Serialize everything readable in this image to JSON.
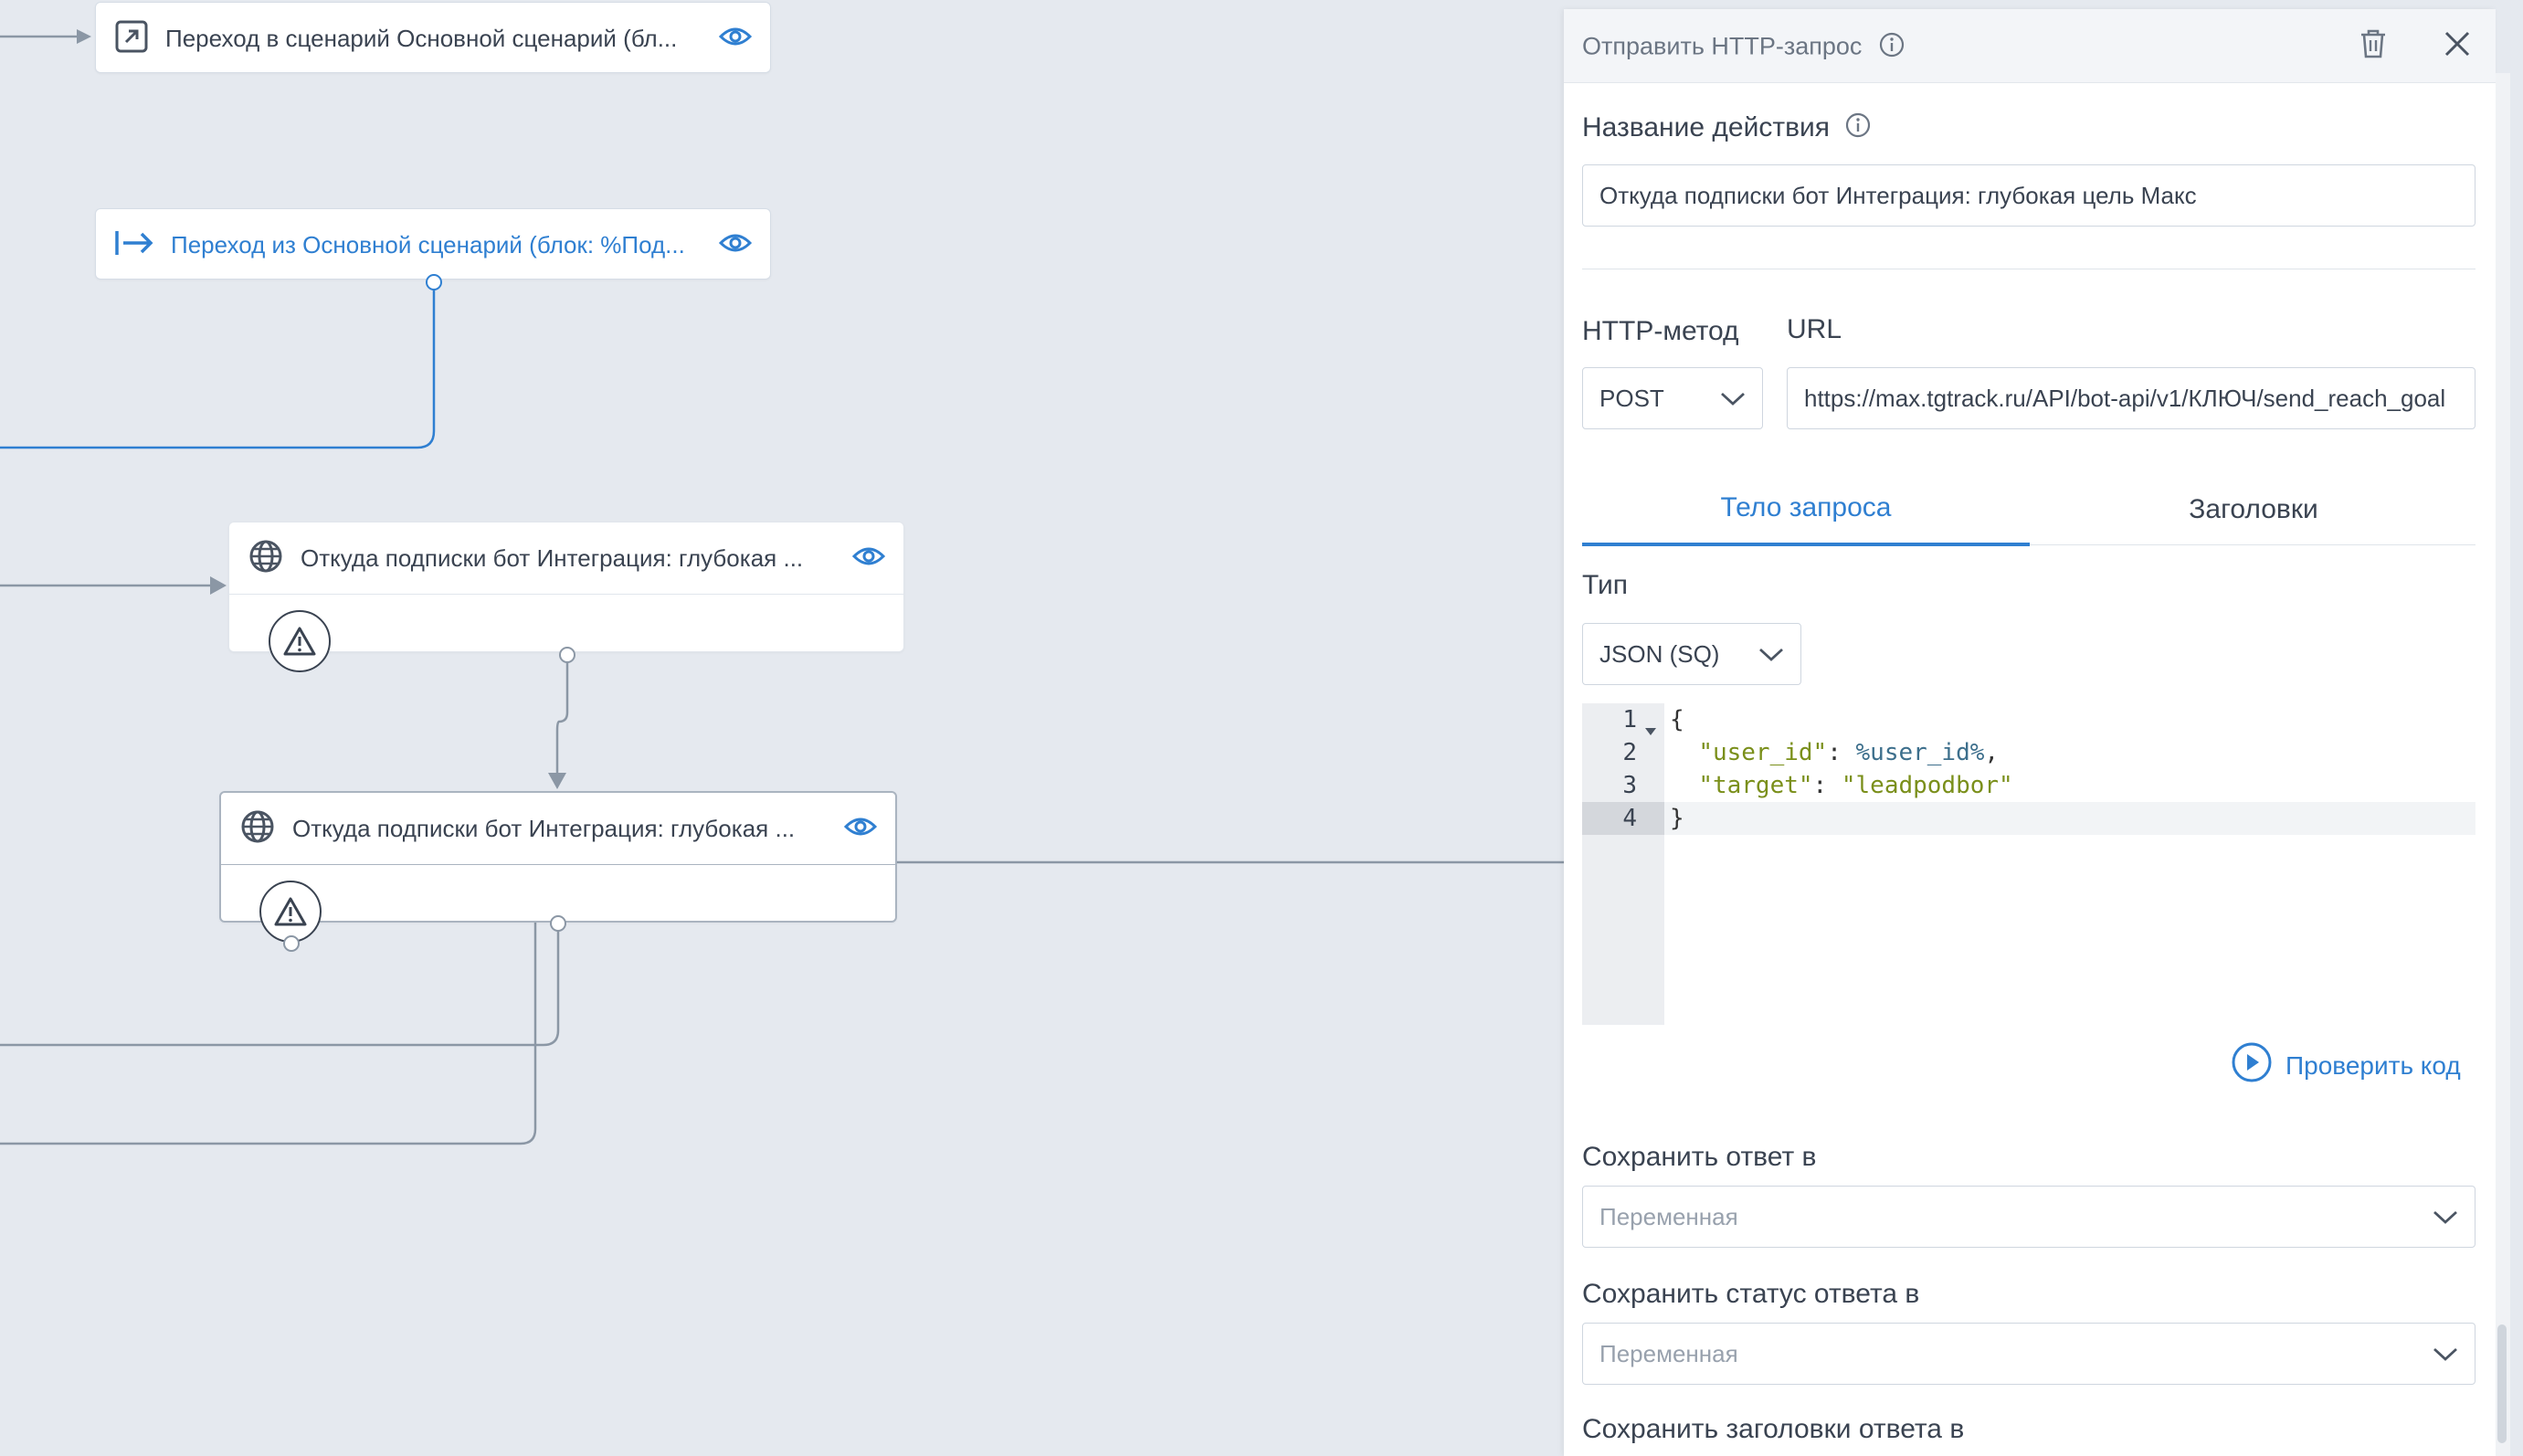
{
  "canvas": {
    "nodes": [
      {
        "title": "Переход в сценарий Основной сценарий (бл...",
        "icon": "jump-in-icon"
      },
      {
        "title": "Переход из Основной сценарий (блок: %Под...",
        "icon": "jump-out-icon"
      },
      {
        "title": "Откуда подписки бот Интеграция: глубокая ...",
        "icon": "globe-icon"
      },
      {
        "title": "Откуда подписки бот Интеграция: глубокая ...",
        "icon": "globe-icon"
      }
    ]
  },
  "panel": {
    "title": "Отправить HTTP-запрос",
    "action_name_label": "Название действия",
    "action_name_value": "Откуда подписки бот Интеграция: глубокая цель Макс",
    "http_method_label": "HTTP-метод",
    "http_method_value": "POST",
    "url_label": "URL",
    "url_value": "https://max.tgtrack.ru/API/bot-api/v1/КЛЮЧ/send_reach_goal",
    "tabs": [
      "Тело запроса",
      "Заголовки"
    ],
    "active_tab": 0,
    "type_label": "Тип",
    "type_value": "JSON (SQ)",
    "code": {
      "line_numbers": [
        "1",
        "2",
        "3",
        "4"
      ],
      "lines": [
        "{",
        "  \"user_id\": %user_id%,",
        "  \"target\": \"leadpodbor\"",
        "}"
      ]
    },
    "check_code_label": "Проверить код",
    "save_response_label": "Сохранить ответ в",
    "save_response_placeholder": "Переменная",
    "save_status_label": "Сохранить статус ответа в",
    "save_status_placeholder": "Переменная",
    "save_headers_label": "Сохранить заголовки ответа в"
  },
  "colors": {
    "canvas_bg": "#e5e9ef",
    "accent": "#2f7fd1",
    "wire": "#8b97a5",
    "code_string": "#7a8f1a"
  }
}
